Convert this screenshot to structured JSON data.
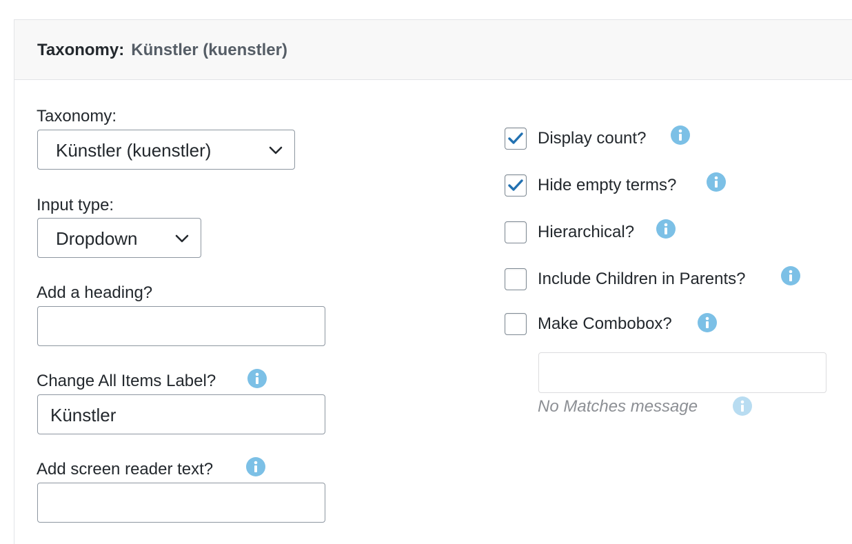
{
  "header": {
    "label": "Taxonomy:",
    "value": "Künstler (kuenstler)"
  },
  "left": {
    "taxonomy": {
      "label": "Taxonomy:",
      "selected": "Künstler (kuenstler)"
    },
    "input_type": {
      "label": "Input type:",
      "selected": "Dropdown"
    },
    "heading": {
      "label": "Add a heading?",
      "value": ""
    },
    "all_items_label": {
      "label": "Change All Items Label?",
      "value": "Künstler"
    },
    "screen_reader": {
      "label": "Add screen reader text?",
      "value": ""
    }
  },
  "right": {
    "options": [
      {
        "label": "Display count?",
        "checked": true
      },
      {
        "label": "Hide empty terms?",
        "checked": true
      },
      {
        "label": "Hierarchical?",
        "checked": false
      },
      {
        "label": "Include Children in Parents?",
        "checked": false
      },
      {
        "label": "Make Combobox?",
        "checked": false
      }
    ],
    "combobox": {
      "value": "",
      "hint": "No Matches message"
    }
  },
  "colors": {
    "accent": "#2271b1",
    "info_icon": "#7cc0e6",
    "info_icon_faded": "#b8dcf1",
    "header_bg": "#f8f8f8"
  },
  "icons": {
    "select_caret": "chevron-down-icon",
    "help": "info-icon",
    "checked": "checkmark-icon"
  }
}
